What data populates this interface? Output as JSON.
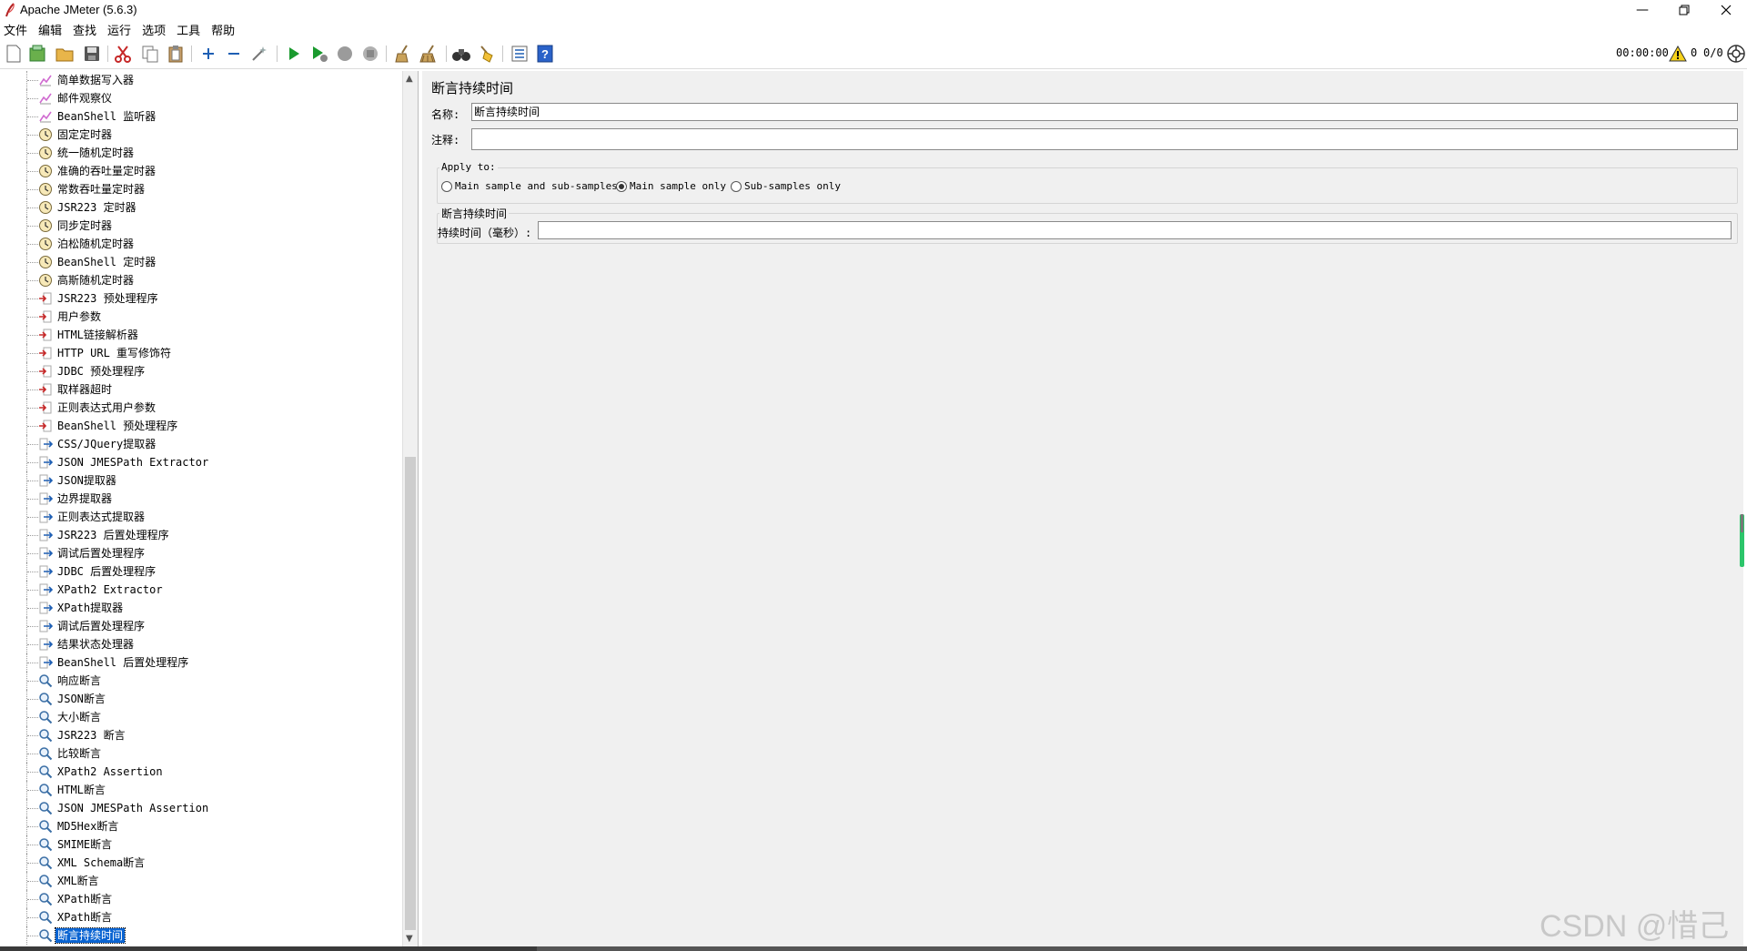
{
  "window": {
    "title": "Apache JMeter (5.6.3)"
  },
  "menu": [
    "文件",
    "编辑",
    "查找",
    "运行",
    "选项",
    "工具",
    "帮助"
  ],
  "toolbar": {
    "timer": "00:00:00",
    "warning_count": "0",
    "thread_count": "0/0"
  },
  "tree": {
    "items": [
      {
        "label": "简单数据写入器",
        "icon": "listener-icon"
      },
      {
        "label": "邮件观察仪",
        "icon": "listener-icon"
      },
      {
        "label": "BeanShell 监听器",
        "icon": "listener-icon"
      },
      {
        "label": "固定定时器",
        "icon": "timer-icon"
      },
      {
        "label": "统一随机定时器",
        "icon": "timer-icon"
      },
      {
        "label": "准确的吞吐量定时器",
        "icon": "timer-icon"
      },
      {
        "label": "常数吞吐量定时器",
        "icon": "timer-icon"
      },
      {
        "label": "JSR223 定时器",
        "icon": "timer-icon"
      },
      {
        "label": "同步定时器",
        "icon": "timer-icon"
      },
      {
        "label": "泊松随机定时器",
        "icon": "timer-icon"
      },
      {
        "label": "BeanShell 定时器",
        "icon": "timer-icon"
      },
      {
        "label": "高斯随机定时器",
        "icon": "timer-icon"
      },
      {
        "label": "JSR223 预处理程序",
        "icon": "preprocessor-icon"
      },
      {
        "label": "用户参数",
        "icon": "preprocessor-icon"
      },
      {
        "label": "HTML链接解析器",
        "icon": "preprocessor-icon"
      },
      {
        "label": "HTTP URL 重写修饰符",
        "icon": "preprocessor-icon"
      },
      {
        "label": "JDBC 预处理程序",
        "icon": "preprocessor-icon"
      },
      {
        "label": "取样器超时",
        "icon": "preprocessor-icon"
      },
      {
        "label": "正则表达式用户参数",
        "icon": "preprocessor-icon"
      },
      {
        "label": "BeanShell 预处理程序",
        "icon": "preprocessor-icon"
      },
      {
        "label": "CSS/JQuery提取器",
        "icon": "postprocessor-icon"
      },
      {
        "label": "JSON JMESPath Extractor",
        "icon": "postprocessor-icon"
      },
      {
        "label": "JSON提取器",
        "icon": "postprocessor-icon"
      },
      {
        "label": "边界提取器",
        "icon": "postprocessor-icon"
      },
      {
        "label": "正则表达式提取器",
        "icon": "postprocessor-icon"
      },
      {
        "label": "JSR223 后置处理程序",
        "icon": "postprocessor-icon"
      },
      {
        "label": "调试后置处理程序",
        "icon": "postprocessor-icon"
      },
      {
        "label": "JDBC 后置处理程序",
        "icon": "postprocessor-icon"
      },
      {
        "label": "XPath2 Extractor",
        "icon": "postprocessor-icon"
      },
      {
        "label": "XPath提取器",
        "icon": "postprocessor-icon"
      },
      {
        "label": "调试后置处理程序",
        "icon": "postprocessor-icon"
      },
      {
        "label": "结果状态处理器",
        "icon": "postprocessor-icon"
      },
      {
        "label": "BeanShell 后置处理程序",
        "icon": "postprocessor-icon"
      },
      {
        "label": "响应断言",
        "icon": "assertion-icon"
      },
      {
        "label": "JSON断言",
        "icon": "assertion-icon"
      },
      {
        "label": "大小断言",
        "icon": "assertion-icon"
      },
      {
        "label": "JSR223 断言",
        "icon": "assertion-icon"
      },
      {
        "label": "比较断言",
        "icon": "assertion-icon"
      },
      {
        "label": "XPath2 Assertion",
        "icon": "assertion-icon"
      },
      {
        "label": "HTML断言",
        "icon": "assertion-icon"
      },
      {
        "label": "JSON JMESPath Assertion",
        "icon": "assertion-icon"
      },
      {
        "label": "MD5Hex断言",
        "icon": "assertion-icon"
      },
      {
        "label": "SMIME断言",
        "icon": "assertion-icon"
      },
      {
        "label": "XML Schema断言",
        "icon": "assertion-icon"
      },
      {
        "label": "XML断言",
        "icon": "assertion-icon"
      },
      {
        "label": "XPath断言",
        "icon": "assertion-icon"
      },
      {
        "label": "XPath断言",
        "icon": "assertion-icon"
      },
      {
        "label": "断言持续时间",
        "icon": "assertion-icon",
        "selected": true
      }
    ]
  },
  "editor": {
    "title": "断言持续时间",
    "name_label": "名称:",
    "name_value": "断言持续时间",
    "comment_label": "注释:",
    "comment_value": "",
    "apply_to_title": "Apply to:",
    "apply_options": [
      {
        "label": "Main sample and sub-samples",
        "checked": false
      },
      {
        "label": "Main sample only",
        "checked": true
      },
      {
        "label": "Sub-samples only",
        "checked": false
      }
    ],
    "duration_group_title": "断言持续时间",
    "duration_label": "持续时间（毫秒）:",
    "duration_value": ""
  },
  "watermark": "CSDN @惜己",
  "colors": {
    "selection": "#0a64d2",
    "panel_bg": "#f0f0f0",
    "run_green": "#1a9a2e",
    "status_green": "#2cc56a"
  }
}
